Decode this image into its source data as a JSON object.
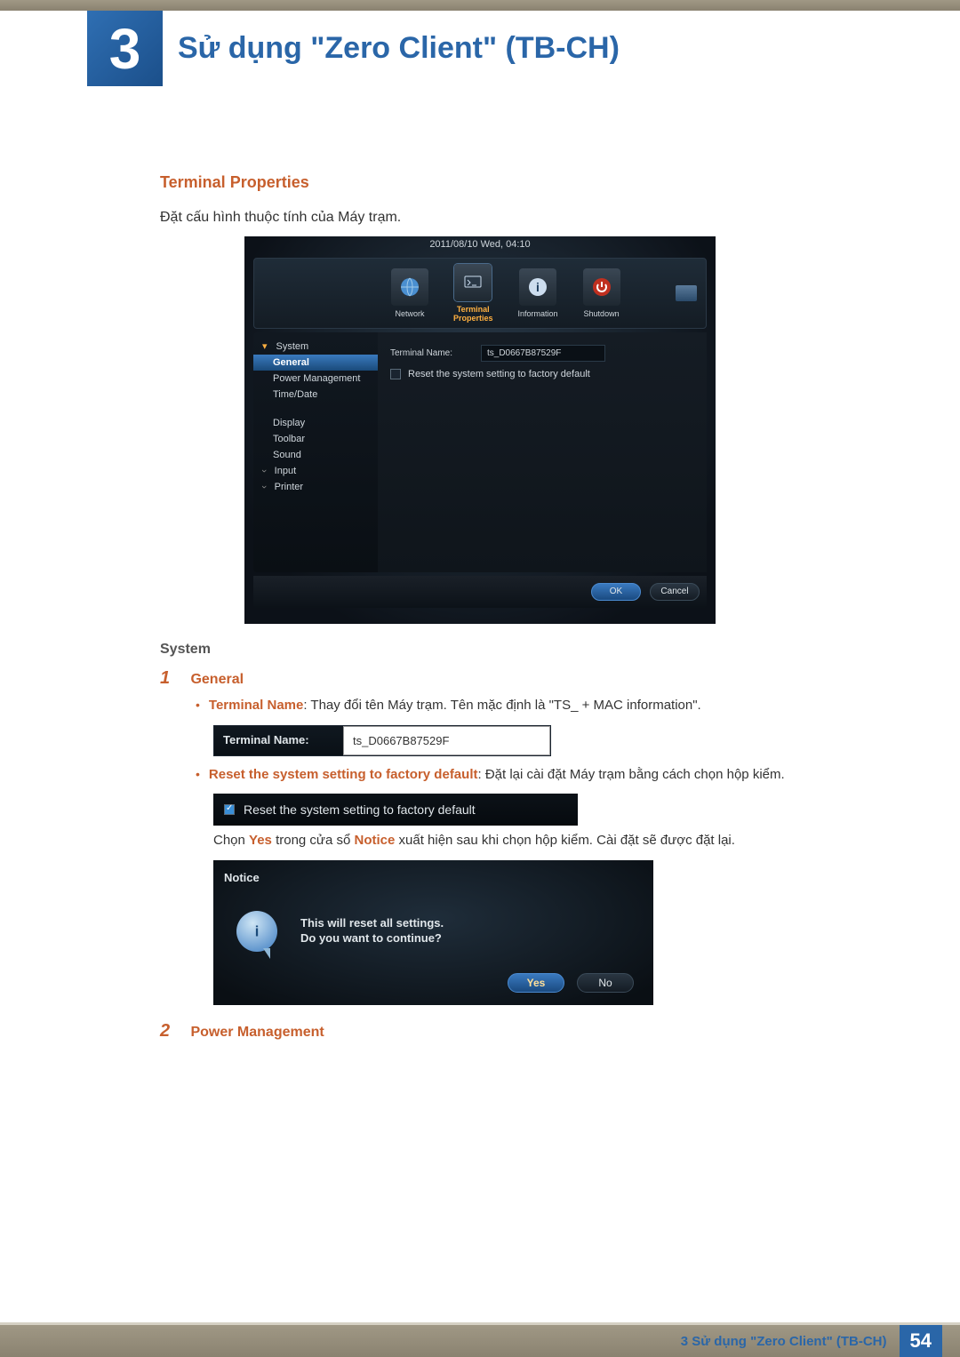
{
  "chapter_num": "3",
  "chapter_title": "Sử dụng \"Zero Client\" (TB-CH)",
  "heading": "Terminal Properties",
  "intro": "Đặt cấu hình thuộc tính của Máy trạm.",
  "ss1": {
    "datetime": "2011/08/10 Wed, 04:10",
    "toolbar": {
      "network": "Network",
      "terminal": "Terminal",
      "properties": "Properties",
      "information": "Information",
      "shutdown": "Shutdown"
    },
    "tree": {
      "system": "System",
      "general": "General",
      "power": "Power Management",
      "timedate": "Time/Date",
      "display": "Display",
      "toolbar": "Toolbar",
      "sound": "Sound",
      "input": "Input",
      "printer": "Printer"
    },
    "panel": {
      "terminal_name_label": "Terminal Name:",
      "terminal_name_value": "ts_D0667B87529F",
      "reset_label": "Reset the system setting to factory default"
    },
    "footer": {
      "ok": "OK",
      "cancel": "Cancel"
    }
  },
  "system_heading": "System",
  "item1": {
    "num": "1",
    "title": "General",
    "bullet1_strong": "Terminal Name",
    "bullet1_rest": ": Thay đổi tên Máy trạm. Tên mặc định là \"TS_ + MAC information\".",
    "ss2_label": "Terminal Name:",
    "ss2_value": "ts_D0667B87529F",
    "bullet2_strong": "Reset the system setting to factory default",
    "bullet2_rest": ": Đặt lại cài đặt Máy trạm bằng cách chọn hộp kiểm.",
    "ss3_text": "Reset the system setting to factory default",
    "after_ss3_pre": "Chọn ",
    "after_ss3_yes": "Yes",
    "after_ss3_mid": " trong cửa sổ ",
    "after_ss3_notice": "Notice",
    "after_ss3_post": " xuất hiện sau khi chọn hộp kiểm. Cài đặt sẽ được đặt lại."
  },
  "ss4": {
    "title": "Notice",
    "line1": "This will reset all settings.",
    "line2": "Do you want to continue?",
    "yes": "Yes",
    "no": "No"
  },
  "item2": {
    "num": "2",
    "title": "Power Management"
  },
  "footer_label": "3 Sử dụng \"Zero Client\" (TB-CH)",
  "page_num": "54"
}
